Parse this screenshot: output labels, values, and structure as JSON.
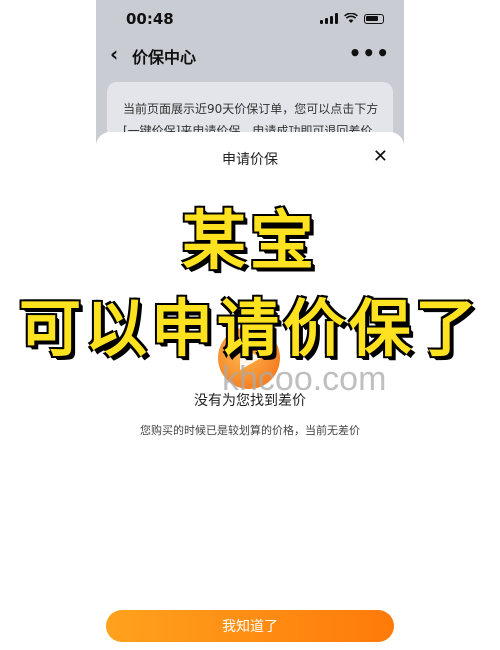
{
  "status_bar": {
    "time": "00:48"
  },
  "nav": {
    "back_icon": "chevron-left-icon",
    "title": "价保中心",
    "more_icon": "more-icon"
  },
  "notice": {
    "line1": "当前页面展示近90天价保订单，您可以点击下方",
    "line2": "[一键价保]来申请价保，申请成功即可退回差价"
  },
  "sheet": {
    "title": "申请价保",
    "close_icon": "close-icon",
    "empty_icon": "play-icon",
    "empty_main": "没有为您找到差价",
    "empty_sub": "您购买的时候已是较划算的价格，当前无差价",
    "ok_label": "我知道了"
  },
  "overlay": {
    "line1": "某宝",
    "line2": "可以申请价保了",
    "watermark": "khcoo.com"
  },
  "colors": {
    "overlay_text": "#ffe21f",
    "accent": "#ff8a12",
    "backdrop": "#c9ccd3"
  }
}
